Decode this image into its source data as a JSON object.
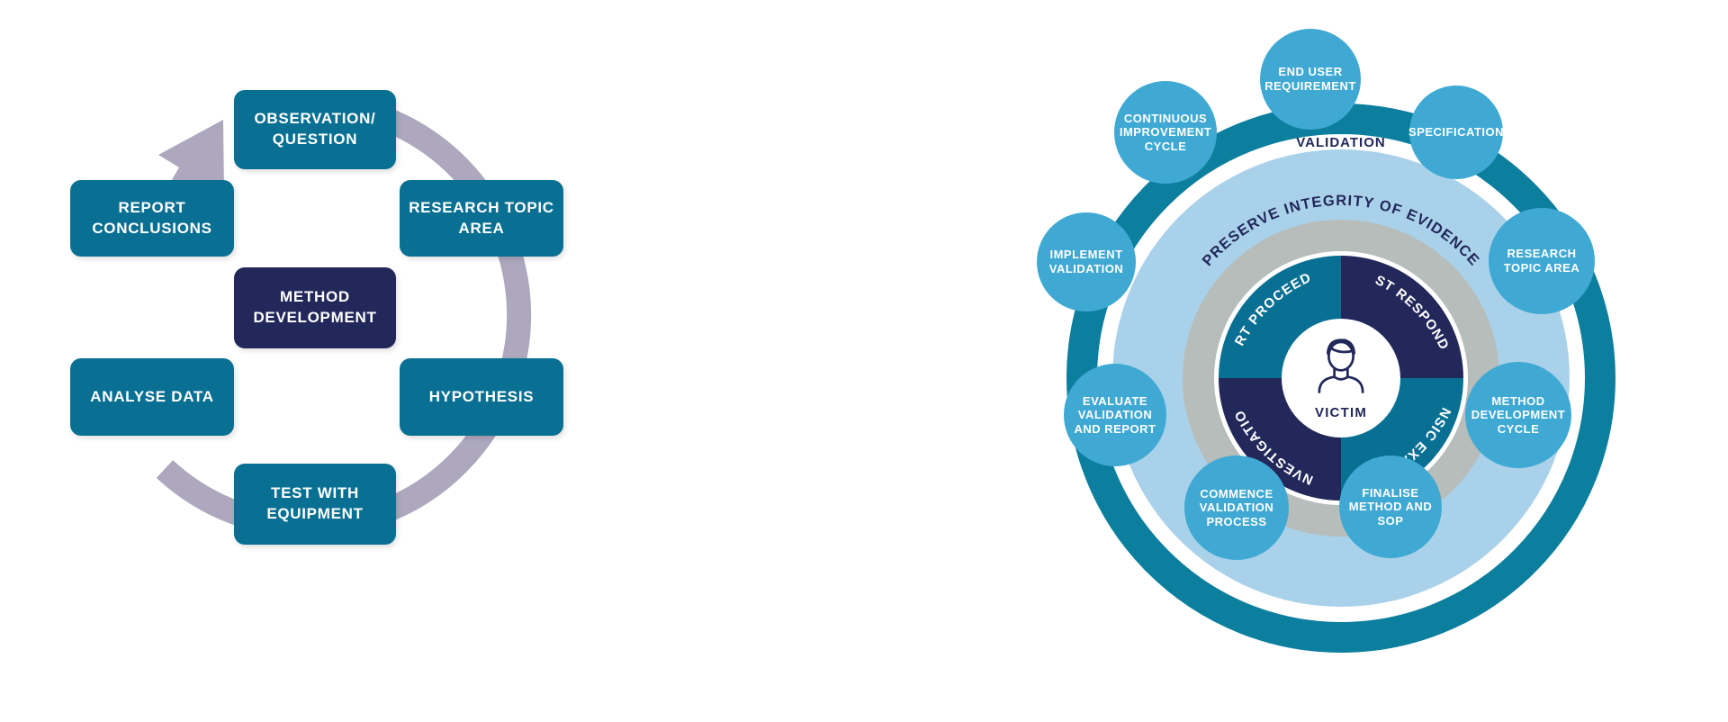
{
  "left_diagram": {
    "name": "scientific-method-cycle",
    "center_box": {
      "label": "METHOD\nDEVELOPMENT",
      "color": "#22285a"
    },
    "box_color": "#0a7093",
    "arrow_color": "#ada8be",
    "steps": [
      {
        "id": "observation-question",
        "label": "OBSERVATION/\nQUESTION"
      },
      {
        "id": "research-topic-area",
        "label": "RESEARCH TOPIC\nAREA"
      },
      {
        "id": "hypothesis",
        "label": "HYPOTHESIS"
      },
      {
        "id": "test-with-equipment",
        "label": "TEST WITH\nEQUIPMENT"
      },
      {
        "id": "analyse-data",
        "label": "ANALYSE DATA"
      },
      {
        "id": "report-conclusions",
        "label": "REPORT\nCONCLUSIONS"
      }
    ]
  },
  "right_diagram": {
    "name": "validation-wheel",
    "colors": {
      "outer_ring": "#0d7f9e",
      "mid_ring": "#a9d2ea",
      "grey_ring": "#b6bdba",
      "bubble": "#3fa9d4",
      "quad_teal": "#0a7093",
      "quad_navy": "#22285a",
      "core": "#ffffff"
    },
    "ring_label": "VALIDATION",
    "grey_ring_label": "PRESERVE INTEGRITY OF EVIDENCE",
    "core_label": "VICTIM",
    "quadrants": [
      {
        "id": "first-responder",
        "label": "FIRST RESPONDER",
        "color": "#22285a"
      },
      {
        "id": "forensic-examination",
        "label": "FORENSIC EXAMINATION",
        "color": "#0a7093"
      },
      {
        "id": "investigation",
        "label": "INVESTIGATION",
        "color": "#22285a"
      },
      {
        "id": "court-proceeding",
        "label": "COURT PROCEEDING",
        "color": "#0a7093"
      }
    ],
    "bubbles": [
      {
        "id": "end-user-requirement",
        "label": "END USER\nREQUIREMENT"
      },
      {
        "id": "specification",
        "label": "SPECIFICATION"
      },
      {
        "id": "research-topic-area",
        "label": "RESEARCH\nTOPIC AREA"
      },
      {
        "id": "method-development-cycle",
        "label": "METHOD\nDEVELOPMENT\nCYCLE"
      },
      {
        "id": "finalise-method-and-sop",
        "label": "FINALISE\nMETHOD AND\nSOP"
      },
      {
        "id": "commence-validation-process",
        "label": "COMMENCE\nVALIDATION\nPROCESS"
      },
      {
        "id": "evaluate-validation-and-report",
        "label": "EVALUATE\nVALIDATION\nAND REPORT"
      },
      {
        "id": "implement-validation",
        "label": "IMPLEMENT\nVALIDATION"
      },
      {
        "id": "continuous-improvement-cycle",
        "label": "CONTINUOUS\nIMPROVEMENT\nCYCLE"
      }
    ]
  }
}
